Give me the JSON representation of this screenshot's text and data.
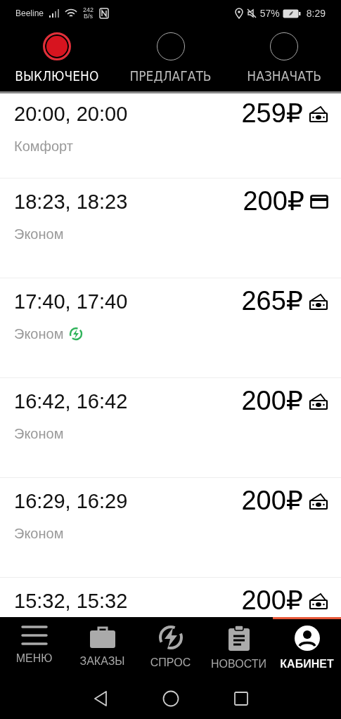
{
  "status_bar": {
    "carrier": "Beeline",
    "speed_value": "242",
    "speed_unit": "B/s",
    "battery": "57%",
    "time": "8:29"
  },
  "modes": [
    {
      "label": "ВЫКЛЮЧЕНО",
      "selected": true
    },
    {
      "label": "ПРЕДЛАГАТЬ",
      "selected": false
    },
    {
      "label": "НАЗНАЧАТЬ",
      "selected": false
    }
  ],
  "orders": [
    {
      "time": "20:00, 20:00",
      "price": "259₽",
      "kind": "cash",
      "class": "Комфорт",
      "surge": false
    },
    {
      "time": "18:23, 18:23",
      "price": "200₽",
      "kind": "card",
      "class": "Эконом",
      "surge": false
    },
    {
      "time": "17:40, 17:40",
      "price": "265₽",
      "kind": "cash",
      "class": "Эконом",
      "surge": true
    },
    {
      "time": "16:42, 16:42",
      "price": "200₽",
      "kind": "cash",
      "class": "Эконом",
      "surge": false
    },
    {
      "time": "16:29, 16:29",
      "price": "200₽",
      "kind": "cash",
      "class": "Эконом",
      "surge": false
    },
    {
      "time": "15:32, 15:32",
      "price": "200₽",
      "kind": "cash"
    }
  ],
  "bottom_nav": [
    {
      "kind": "menu",
      "label": "МЕНЮ",
      "selected": false
    },
    {
      "kind": "orders",
      "label": "ЗАКАЗЫ",
      "selected": false
    },
    {
      "kind": "demand",
      "label": "СПРОС",
      "selected": false
    },
    {
      "kind": "news",
      "label": "НОВОСТИ",
      "selected": false
    },
    {
      "kind": "account",
      "label": "КАБИНЕТ",
      "selected": true
    }
  ]
}
